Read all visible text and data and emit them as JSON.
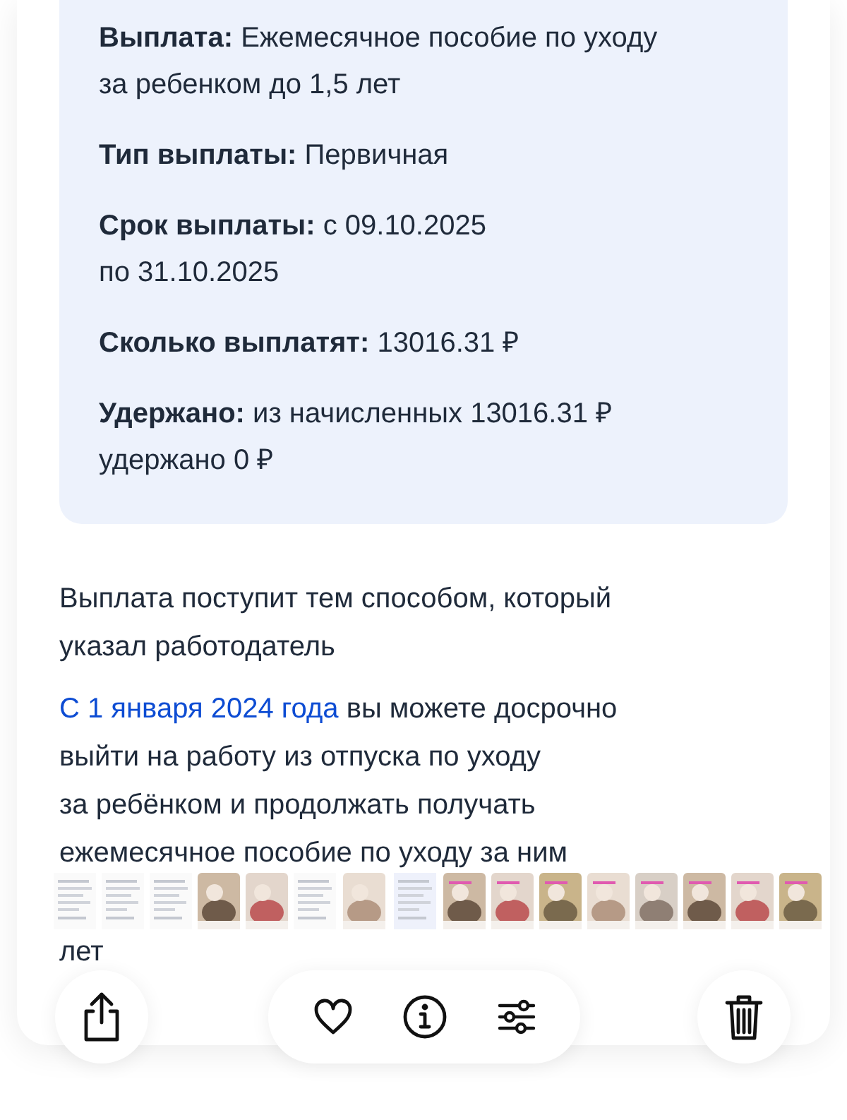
{
  "details": [
    {
      "label": "Выплата:",
      "value": "Ежемесячное пособие по уходу\nза ребенком до 1,5 лет"
    },
    {
      "label": "Тип выплаты:",
      "value": "Первичная"
    },
    {
      "label": "Срок выплаты:",
      "value": "с 09.10.2025\nпо 31.10.2025"
    },
    {
      "label": "Сколько выплатят:",
      "value": "13016.31 ₽"
    },
    {
      "label": "Удержано:",
      "value": "из начисленных 13016.31 ₽\nудержано 0 ₽"
    }
  ],
  "notice": "Выплата поступит тем способом, который\nуказал работодатель",
  "info": {
    "link": "С 1 января 2024 года",
    "text": "вы можете досрочно\nвыйти на работу из отпуска по уходу\nза ребёнком и продолжать получать\nежемесячное пособие по уходу за ним",
    "tail": "лет"
  }
}
